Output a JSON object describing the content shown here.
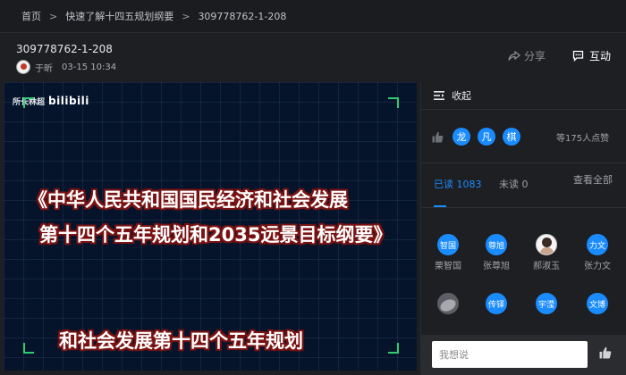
{
  "breadcrumb": {
    "home": "首页",
    "section": "快速了解十四五规划纲要",
    "current": "309778762-1-208",
    "separator": ">"
  },
  "header": {
    "title": "309778762-1-208",
    "author": "于昕",
    "timestamp": "03-15 10:34",
    "share_label": "分享",
    "interact_label": "互动"
  },
  "video": {
    "watermark_text": "所长林超",
    "watermark_logo": "bilibili",
    "line1": "《中华人民共和国国民经济和社会发展",
    "line2": "第十四个五年规划和2035远景目标纲要》",
    "line3": "和社会发展第十四个五年规划",
    "accent_color": "#2ecc71"
  },
  "panel": {
    "collapse_label": "收起",
    "like_avatars": [
      "龙",
      "凡",
      "棋"
    ],
    "like_count_text": "等175人点赞",
    "tabs": {
      "read_label": "已读 1083",
      "unread_label": "未读 0"
    },
    "view_all_label": "查看全部",
    "readers": [
      {
        "avatar": "智国",
        "name": "栗智国",
        "type": "text"
      },
      {
        "avatar": "尊旭",
        "name": "张尊旭",
        "type": "text"
      },
      {
        "avatar": "",
        "name": "郝淑玉",
        "type": "photo"
      },
      {
        "avatar": "力文",
        "name": "张力文",
        "type": "text"
      },
      {
        "avatar": "",
        "name": "",
        "type": "photo2"
      },
      {
        "avatar": "传铎",
        "name": "",
        "type": "text"
      },
      {
        "avatar": "宇滢",
        "name": "",
        "type": "text"
      },
      {
        "avatar": "文博",
        "name": "",
        "type": "text"
      }
    ],
    "comment_placeholder": "我想说",
    "accent_color": "#1a8cff"
  }
}
